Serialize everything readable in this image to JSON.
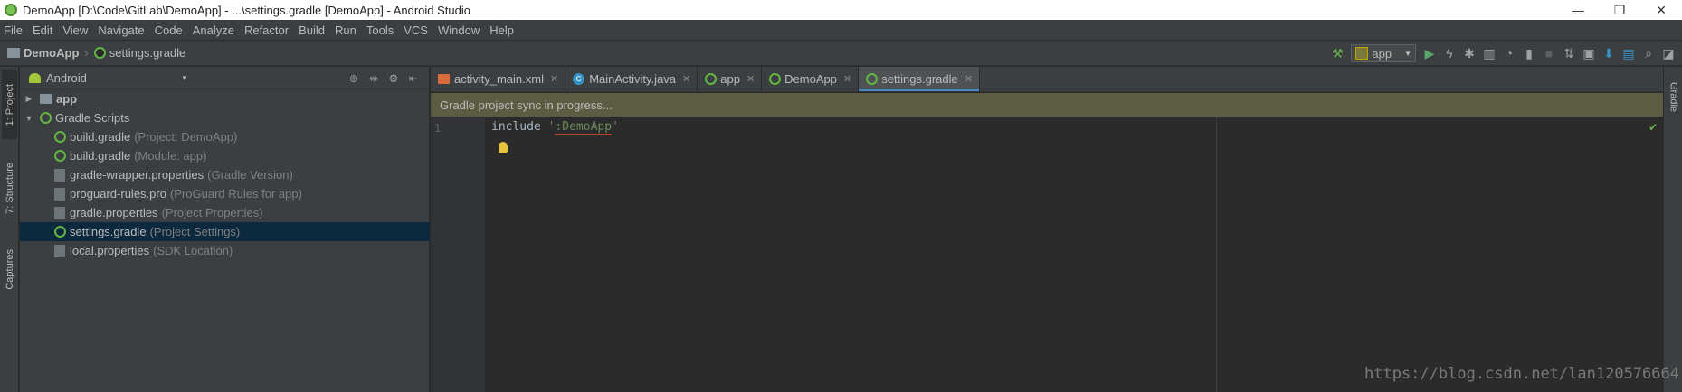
{
  "window": {
    "title": "DemoApp [D:\\Code\\GitLab\\DemoApp] - ...\\settings.gradle [DemoApp] - Android Studio",
    "minimize_glyph": "—",
    "restore_glyph": "❐",
    "close_glyph": "✕"
  },
  "menu": [
    "File",
    "Edit",
    "View",
    "Navigate",
    "Code",
    "Analyze",
    "Refactor",
    "Build",
    "Run",
    "Tools",
    "VCS",
    "Window",
    "Help"
  ],
  "breadcrumb": {
    "project": "DemoApp",
    "file": "settings.gradle"
  },
  "toolbar": {
    "run_config": "app"
  },
  "left_tool_tabs": {
    "project": "1: Project",
    "structure": "7: Structure",
    "captures": "Captures"
  },
  "right_tool_tabs": {
    "gradle": "Gradle"
  },
  "project_panel": {
    "view_mode": "Android",
    "tree": [
      {
        "name": "app",
        "hint": ""
      },
      {
        "name": "Gradle Scripts",
        "hint": ""
      },
      {
        "name": "build.gradle",
        "hint": "(Project: DemoApp)"
      },
      {
        "name": "build.gradle",
        "hint": "(Module: app)"
      },
      {
        "name": "gradle-wrapper.properties",
        "hint": "(Gradle Version)"
      },
      {
        "name": "proguard-rules.pro",
        "hint": "(ProGuard Rules for app)"
      },
      {
        "name": "gradle.properties",
        "hint": "(Project Properties)"
      },
      {
        "name": "settings.gradle",
        "hint": "(Project Settings)"
      },
      {
        "name": "local.properties",
        "hint": "(SDK Location)"
      }
    ]
  },
  "editor": {
    "tabs": [
      {
        "label": "activity_main.xml"
      },
      {
        "label": "MainActivity.java"
      },
      {
        "label": "app"
      },
      {
        "label": "DemoApp"
      },
      {
        "label": "settings.gradle"
      }
    ],
    "banner": "Gradle project sync in progress...",
    "line_number": "1",
    "code_keyword": "include ",
    "code_string_open": "'",
    "code_string_value": ":DemoApp",
    "code_string_close": "'"
  },
  "watermark": "https://blog.csdn.net/lan120576664",
  "colors": {
    "background": "#2b2b2b",
    "panel": "#3c3f41",
    "selection": "#0d293e",
    "banner": "#5c5c42",
    "accent_tab": "#4a88c7",
    "string": "#6a8759",
    "error_underline": "#bc3f3c"
  }
}
